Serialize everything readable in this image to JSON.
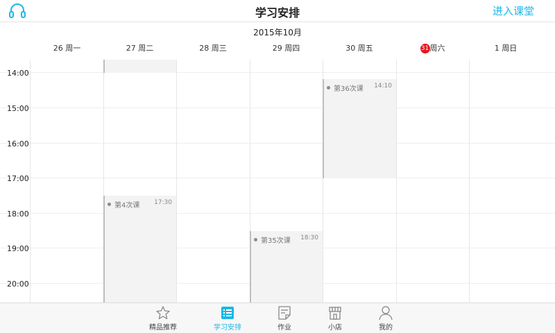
{
  "header": {
    "title": "学习安排",
    "enter_classroom": "进入课堂",
    "left_icon": "headset-icon",
    "accent_color": "#1bb8e8"
  },
  "calendar": {
    "month_label": "2015年10月",
    "days": [
      {
        "date": "26",
        "weekday": "周一"
      },
      {
        "date": "27",
        "weekday": "周二"
      },
      {
        "date": "28",
        "weekday": "周三"
      },
      {
        "date": "29",
        "weekday": "周四"
      },
      {
        "date": "30",
        "weekday": "周五"
      },
      {
        "date": "31",
        "weekday": "周六",
        "today": true
      },
      {
        "date": "1",
        "weekday": "周日"
      }
    ],
    "hours": [
      "14:00",
      "15:00",
      "16:00",
      "17:00",
      "18:00",
      "19:00",
      "20:00"
    ],
    "today_color": "#e8151b",
    "events": [
      {
        "day": "27 周二",
        "name": "",
        "time": ""
      },
      {
        "day": "30 周五",
        "name": "第36次课",
        "time": "14:10"
      },
      {
        "day": "27 周二",
        "name": "第4次课",
        "time": "17:30"
      },
      {
        "day": "29 周四",
        "name": "第35次课",
        "time": "18:30"
      }
    ]
  },
  "tabbar": {
    "items": [
      {
        "label": "精品推荐",
        "icon": "star-icon"
      },
      {
        "label": "学习安排",
        "icon": "schedule-list-icon",
        "active": true
      },
      {
        "label": "作业",
        "icon": "homework-icon"
      },
      {
        "label": "小店",
        "icon": "store-icon"
      },
      {
        "label": "我的",
        "icon": "profile-icon"
      }
    ]
  }
}
